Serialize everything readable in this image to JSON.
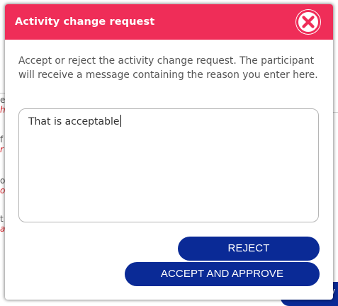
{
  "background": {
    "rows": [
      {
        "dark": "e",
        "red": "h"
      },
      {
        "dark": "f",
        "red": "r"
      },
      {
        "dark": "o",
        "red": "or"
      },
      {
        "dark": "t",
        "red": "a"
      }
    ],
    "partial_button_label": "V"
  },
  "modal": {
    "title": "Activity change request",
    "close_icon": "close-x-circle-icon",
    "instructions": "Accept or reject the activity change request. The participant will receive a message containing the reason you enter here.",
    "reason_value": "That is acceptable",
    "reject_label": "REJECT",
    "accept_label": "ACCEPT AND APPROVE"
  },
  "colors": {
    "header": "#ef2d58",
    "button": "#0a2a96",
    "close_x": "#ef2d58"
  }
}
